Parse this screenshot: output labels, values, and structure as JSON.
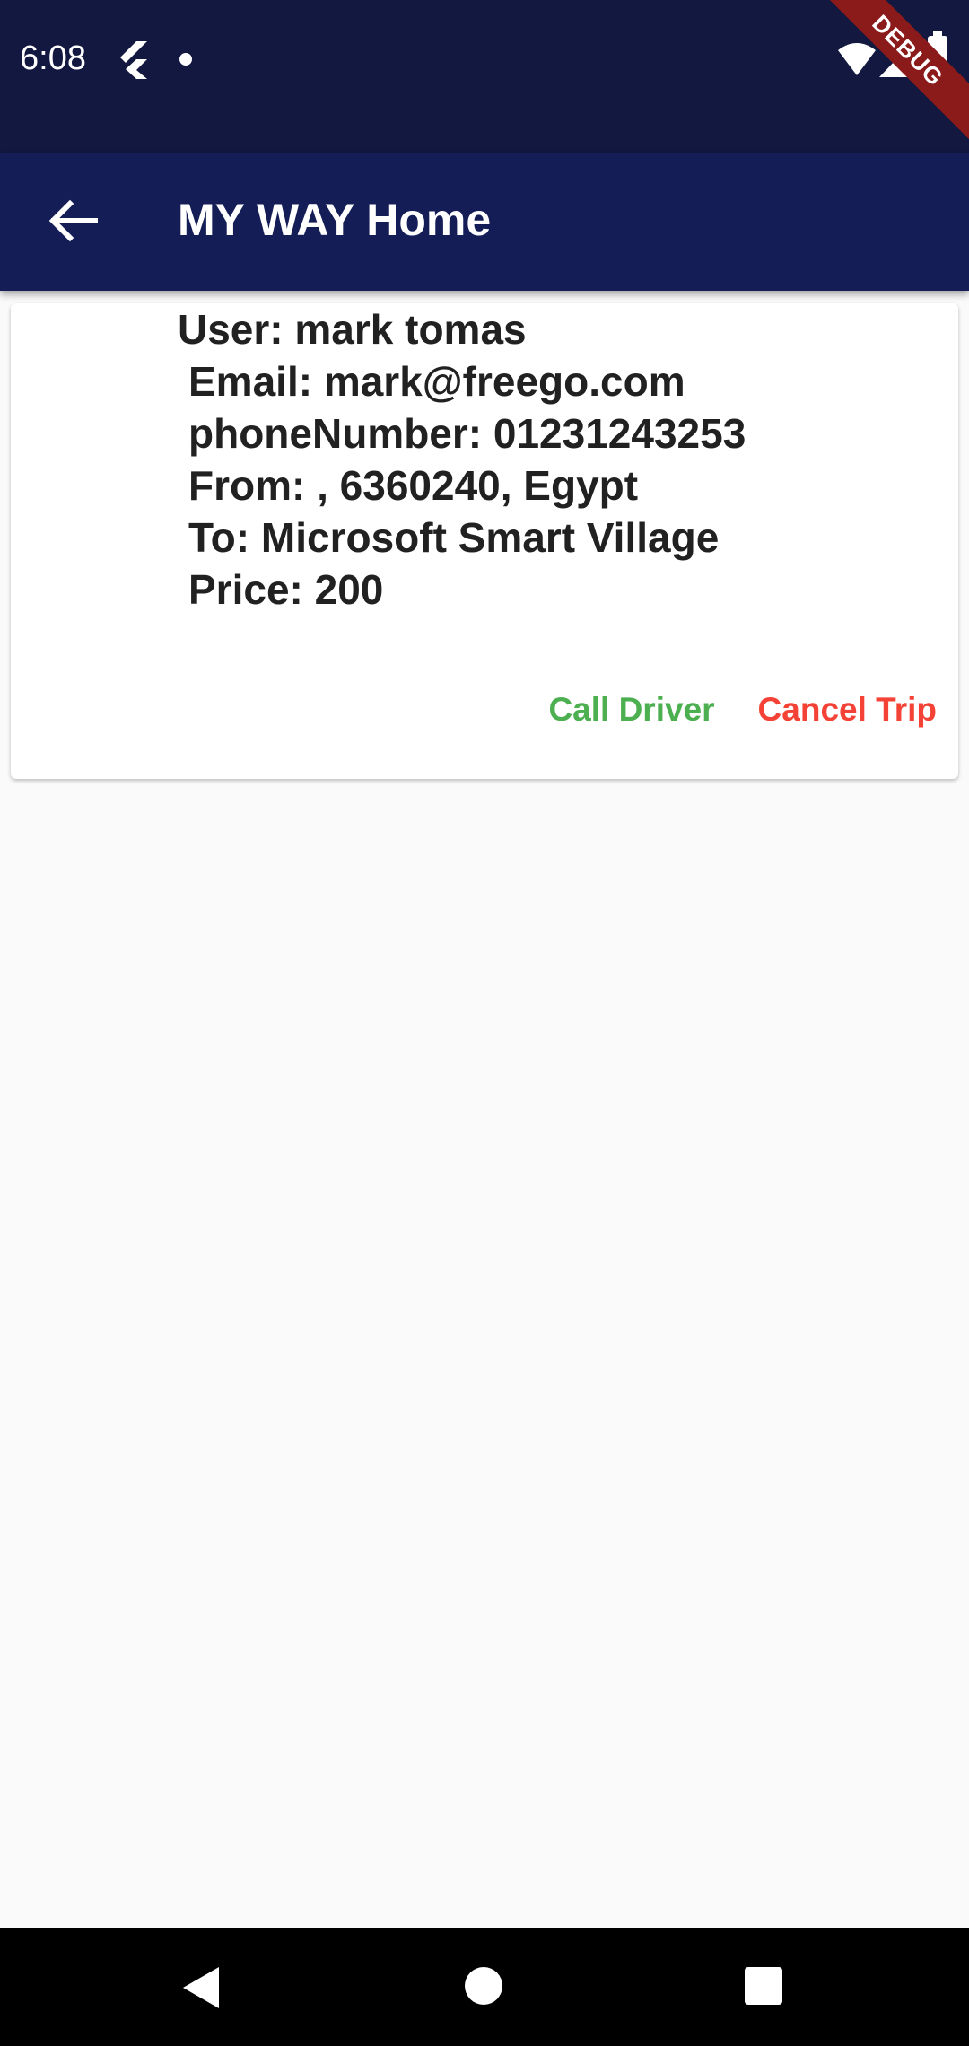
{
  "status_bar": {
    "time": "6:08",
    "icons": [
      "flutter-icon",
      "notification-dot-icon",
      "wifi-icon",
      "signal-icon",
      "battery-icon"
    ],
    "debug_label": "DEBUG"
  },
  "app_bar": {
    "title": "MY WAY Home",
    "back_icon": "arrow-left-icon"
  },
  "trip_card": {
    "user": "User: mark tomas",
    "email": "Email: mark@freego.com",
    "phone": "phoneNumber: 01231243253",
    "from": "From: , 6360240, Egypt",
    "to": "To: Microsoft Smart Village",
    "price": "Price: 200",
    "call_driver_label": "Call Driver",
    "cancel_trip_label": "Cancel Trip"
  },
  "colors": {
    "status_bar": "#12183f",
    "app_bar": "#151d57",
    "call_driver": "#4caf50",
    "cancel_trip": "#f44336",
    "background": "#fafafa"
  }
}
